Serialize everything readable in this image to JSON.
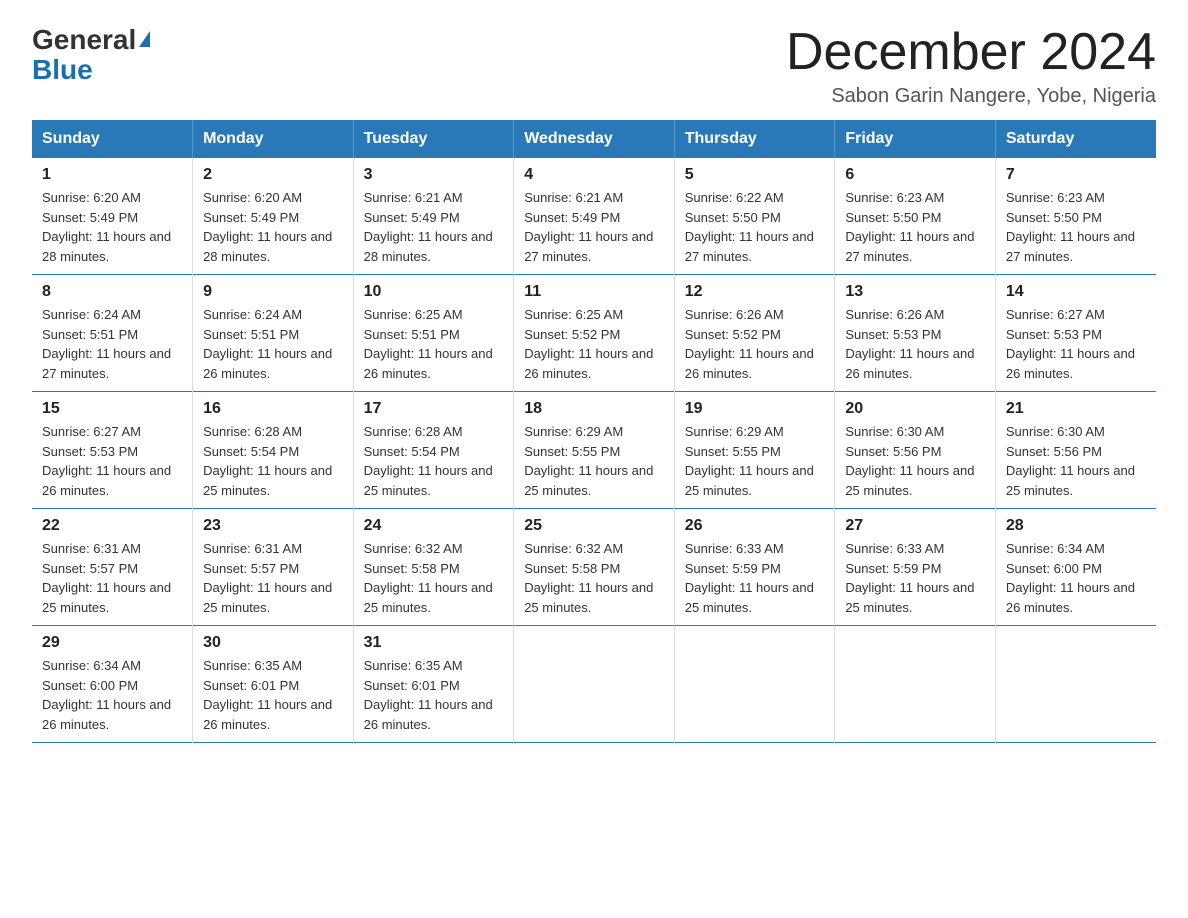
{
  "header": {
    "logo_general": "General",
    "logo_blue": "Blue",
    "month_title": "December 2024",
    "subtitle": "Sabon Garin Nangere, Yobe, Nigeria"
  },
  "days_of_week": [
    "Sunday",
    "Monday",
    "Tuesday",
    "Wednesday",
    "Thursday",
    "Friday",
    "Saturday"
  ],
  "weeks": [
    [
      {
        "day": "1",
        "sunrise": "6:20 AM",
        "sunset": "5:49 PM",
        "daylight": "11 hours and 28 minutes."
      },
      {
        "day": "2",
        "sunrise": "6:20 AM",
        "sunset": "5:49 PM",
        "daylight": "11 hours and 28 minutes."
      },
      {
        "day": "3",
        "sunrise": "6:21 AM",
        "sunset": "5:49 PM",
        "daylight": "11 hours and 28 minutes."
      },
      {
        "day": "4",
        "sunrise": "6:21 AM",
        "sunset": "5:49 PM",
        "daylight": "11 hours and 27 minutes."
      },
      {
        "day": "5",
        "sunrise": "6:22 AM",
        "sunset": "5:50 PM",
        "daylight": "11 hours and 27 minutes."
      },
      {
        "day": "6",
        "sunrise": "6:23 AM",
        "sunset": "5:50 PM",
        "daylight": "11 hours and 27 minutes."
      },
      {
        "day": "7",
        "sunrise": "6:23 AM",
        "sunset": "5:50 PM",
        "daylight": "11 hours and 27 minutes."
      }
    ],
    [
      {
        "day": "8",
        "sunrise": "6:24 AM",
        "sunset": "5:51 PM",
        "daylight": "11 hours and 27 minutes."
      },
      {
        "day": "9",
        "sunrise": "6:24 AM",
        "sunset": "5:51 PM",
        "daylight": "11 hours and 26 minutes."
      },
      {
        "day": "10",
        "sunrise": "6:25 AM",
        "sunset": "5:51 PM",
        "daylight": "11 hours and 26 minutes."
      },
      {
        "day": "11",
        "sunrise": "6:25 AM",
        "sunset": "5:52 PM",
        "daylight": "11 hours and 26 minutes."
      },
      {
        "day": "12",
        "sunrise": "6:26 AM",
        "sunset": "5:52 PM",
        "daylight": "11 hours and 26 minutes."
      },
      {
        "day": "13",
        "sunrise": "6:26 AM",
        "sunset": "5:53 PM",
        "daylight": "11 hours and 26 minutes."
      },
      {
        "day": "14",
        "sunrise": "6:27 AM",
        "sunset": "5:53 PM",
        "daylight": "11 hours and 26 minutes."
      }
    ],
    [
      {
        "day": "15",
        "sunrise": "6:27 AM",
        "sunset": "5:53 PM",
        "daylight": "11 hours and 26 minutes."
      },
      {
        "day": "16",
        "sunrise": "6:28 AM",
        "sunset": "5:54 PM",
        "daylight": "11 hours and 25 minutes."
      },
      {
        "day": "17",
        "sunrise": "6:28 AM",
        "sunset": "5:54 PM",
        "daylight": "11 hours and 25 minutes."
      },
      {
        "day": "18",
        "sunrise": "6:29 AM",
        "sunset": "5:55 PM",
        "daylight": "11 hours and 25 minutes."
      },
      {
        "day": "19",
        "sunrise": "6:29 AM",
        "sunset": "5:55 PM",
        "daylight": "11 hours and 25 minutes."
      },
      {
        "day": "20",
        "sunrise": "6:30 AM",
        "sunset": "5:56 PM",
        "daylight": "11 hours and 25 minutes."
      },
      {
        "day": "21",
        "sunrise": "6:30 AM",
        "sunset": "5:56 PM",
        "daylight": "11 hours and 25 minutes."
      }
    ],
    [
      {
        "day": "22",
        "sunrise": "6:31 AM",
        "sunset": "5:57 PM",
        "daylight": "11 hours and 25 minutes."
      },
      {
        "day": "23",
        "sunrise": "6:31 AM",
        "sunset": "5:57 PM",
        "daylight": "11 hours and 25 minutes."
      },
      {
        "day": "24",
        "sunrise": "6:32 AM",
        "sunset": "5:58 PM",
        "daylight": "11 hours and 25 minutes."
      },
      {
        "day": "25",
        "sunrise": "6:32 AM",
        "sunset": "5:58 PM",
        "daylight": "11 hours and 25 minutes."
      },
      {
        "day": "26",
        "sunrise": "6:33 AM",
        "sunset": "5:59 PM",
        "daylight": "11 hours and 25 minutes."
      },
      {
        "day": "27",
        "sunrise": "6:33 AM",
        "sunset": "5:59 PM",
        "daylight": "11 hours and 25 minutes."
      },
      {
        "day": "28",
        "sunrise": "6:34 AM",
        "sunset": "6:00 PM",
        "daylight": "11 hours and 26 minutes."
      }
    ],
    [
      {
        "day": "29",
        "sunrise": "6:34 AM",
        "sunset": "6:00 PM",
        "daylight": "11 hours and 26 minutes."
      },
      {
        "day": "30",
        "sunrise": "6:35 AM",
        "sunset": "6:01 PM",
        "daylight": "11 hours and 26 minutes."
      },
      {
        "day": "31",
        "sunrise": "6:35 AM",
        "sunset": "6:01 PM",
        "daylight": "11 hours and 26 minutes."
      },
      null,
      null,
      null,
      null
    ]
  ],
  "labels": {
    "sunrise_prefix": "Sunrise: ",
    "sunset_prefix": "Sunset: ",
    "daylight_prefix": "Daylight: "
  }
}
